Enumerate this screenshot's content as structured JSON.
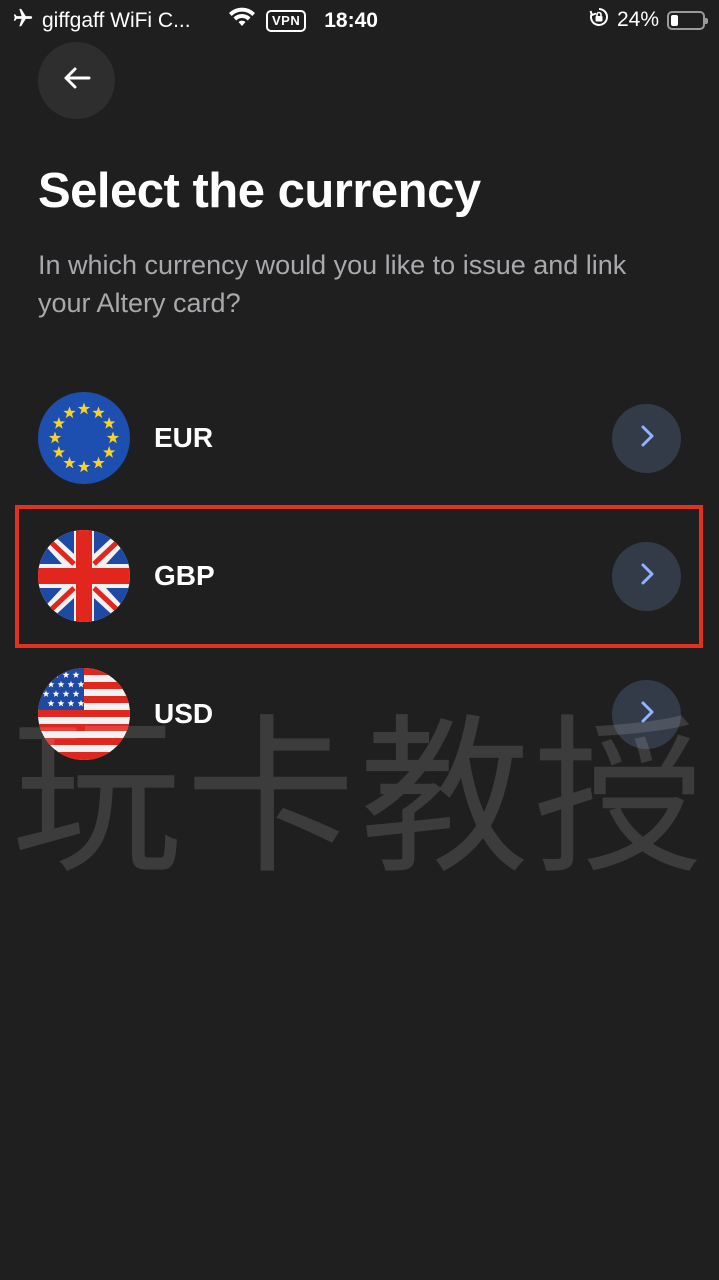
{
  "status_bar": {
    "carrier": "giffgaff WiFi C...",
    "vpn": "VPN",
    "time": "18:40",
    "battery_percent": "24%",
    "battery_level": 0.24,
    "icons": [
      "airplane-icon",
      "wifi-icon",
      "rotation-lock-icon",
      "battery-icon"
    ]
  },
  "back_button": {
    "icon": "arrow-left-icon"
  },
  "title": "Select the currency",
  "subtitle": "In which currency would you like to issue and link your Altery card?",
  "currencies": [
    {
      "code": "EUR",
      "flag": "eu-flag-icon"
    },
    {
      "code": "GBP",
      "flag": "uk-flag-icon",
      "highlighted": true
    },
    {
      "code": "USD",
      "flag": "us-flag-icon"
    }
  ],
  "watermark": "玩卡教授",
  "colors": {
    "background": "#1f1f1f",
    "subtitle": "#a9a9ad",
    "chevron_bg": "#343b48",
    "chevron": "#8fb3ff",
    "highlight": "#e0321e"
  }
}
